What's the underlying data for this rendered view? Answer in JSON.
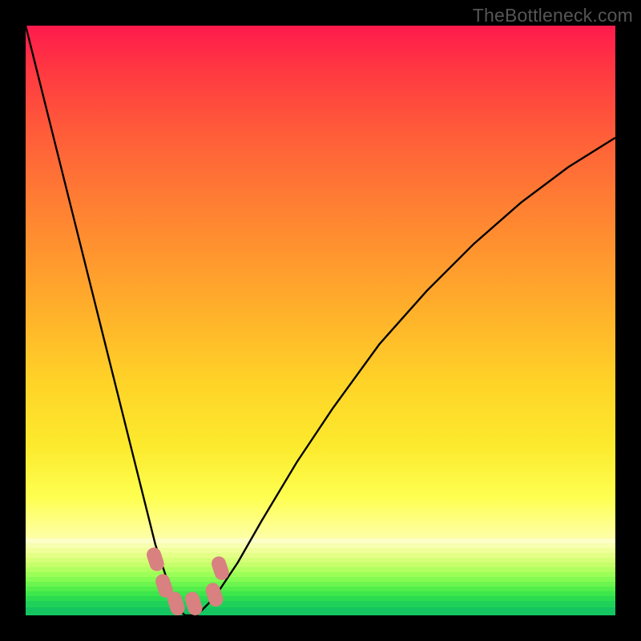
{
  "watermark": "TheBottleneck.com",
  "chart_data": {
    "type": "line",
    "title": "",
    "xlabel": "",
    "ylabel": "",
    "xlim": [
      0,
      100
    ],
    "ylim": [
      0,
      100
    ],
    "grid": false,
    "series": [
      {
        "name": "bottleneck-curve",
        "color": "#000000",
        "x": [
          0,
          4,
          8,
          12,
          16,
          18,
          20,
          22,
          24,
          25,
          26,
          27,
          28,
          29,
          30,
          32,
          36,
          40,
          46,
          52,
          60,
          68,
          76,
          84,
          92,
          100
        ],
        "y": [
          100,
          84,
          68,
          52,
          36,
          28,
          20,
          12,
          6,
          3,
          1,
          0,
          0,
          0,
          1,
          3,
          9,
          16,
          26,
          35,
          46,
          55,
          63,
          70,
          76,
          81
        ]
      }
    ],
    "markers": [
      {
        "name": "pink-marker",
        "x": 22.0,
        "y": 9.5,
        "color": "#d98080"
      },
      {
        "name": "pink-marker",
        "x": 23.5,
        "y": 5.0,
        "color": "#d98080"
      },
      {
        "name": "pink-marker",
        "x": 25.5,
        "y": 2.0,
        "color": "#d98080"
      },
      {
        "name": "pink-marker",
        "x": 28.5,
        "y": 2.0,
        "color": "#d98080"
      },
      {
        "name": "pink-marker",
        "x": 32.0,
        "y": 3.5,
        "color": "#d98080"
      },
      {
        "name": "pink-marker",
        "x": 33.0,
        "y": 8.0,
        "color": "#d98080"
      }
    ],
    "background_gradient": {
      "top_color": "#ff1a4d",
      "mid_color": "#feea30",
      "bottom_color": "#14c560"
    }
  }
}
